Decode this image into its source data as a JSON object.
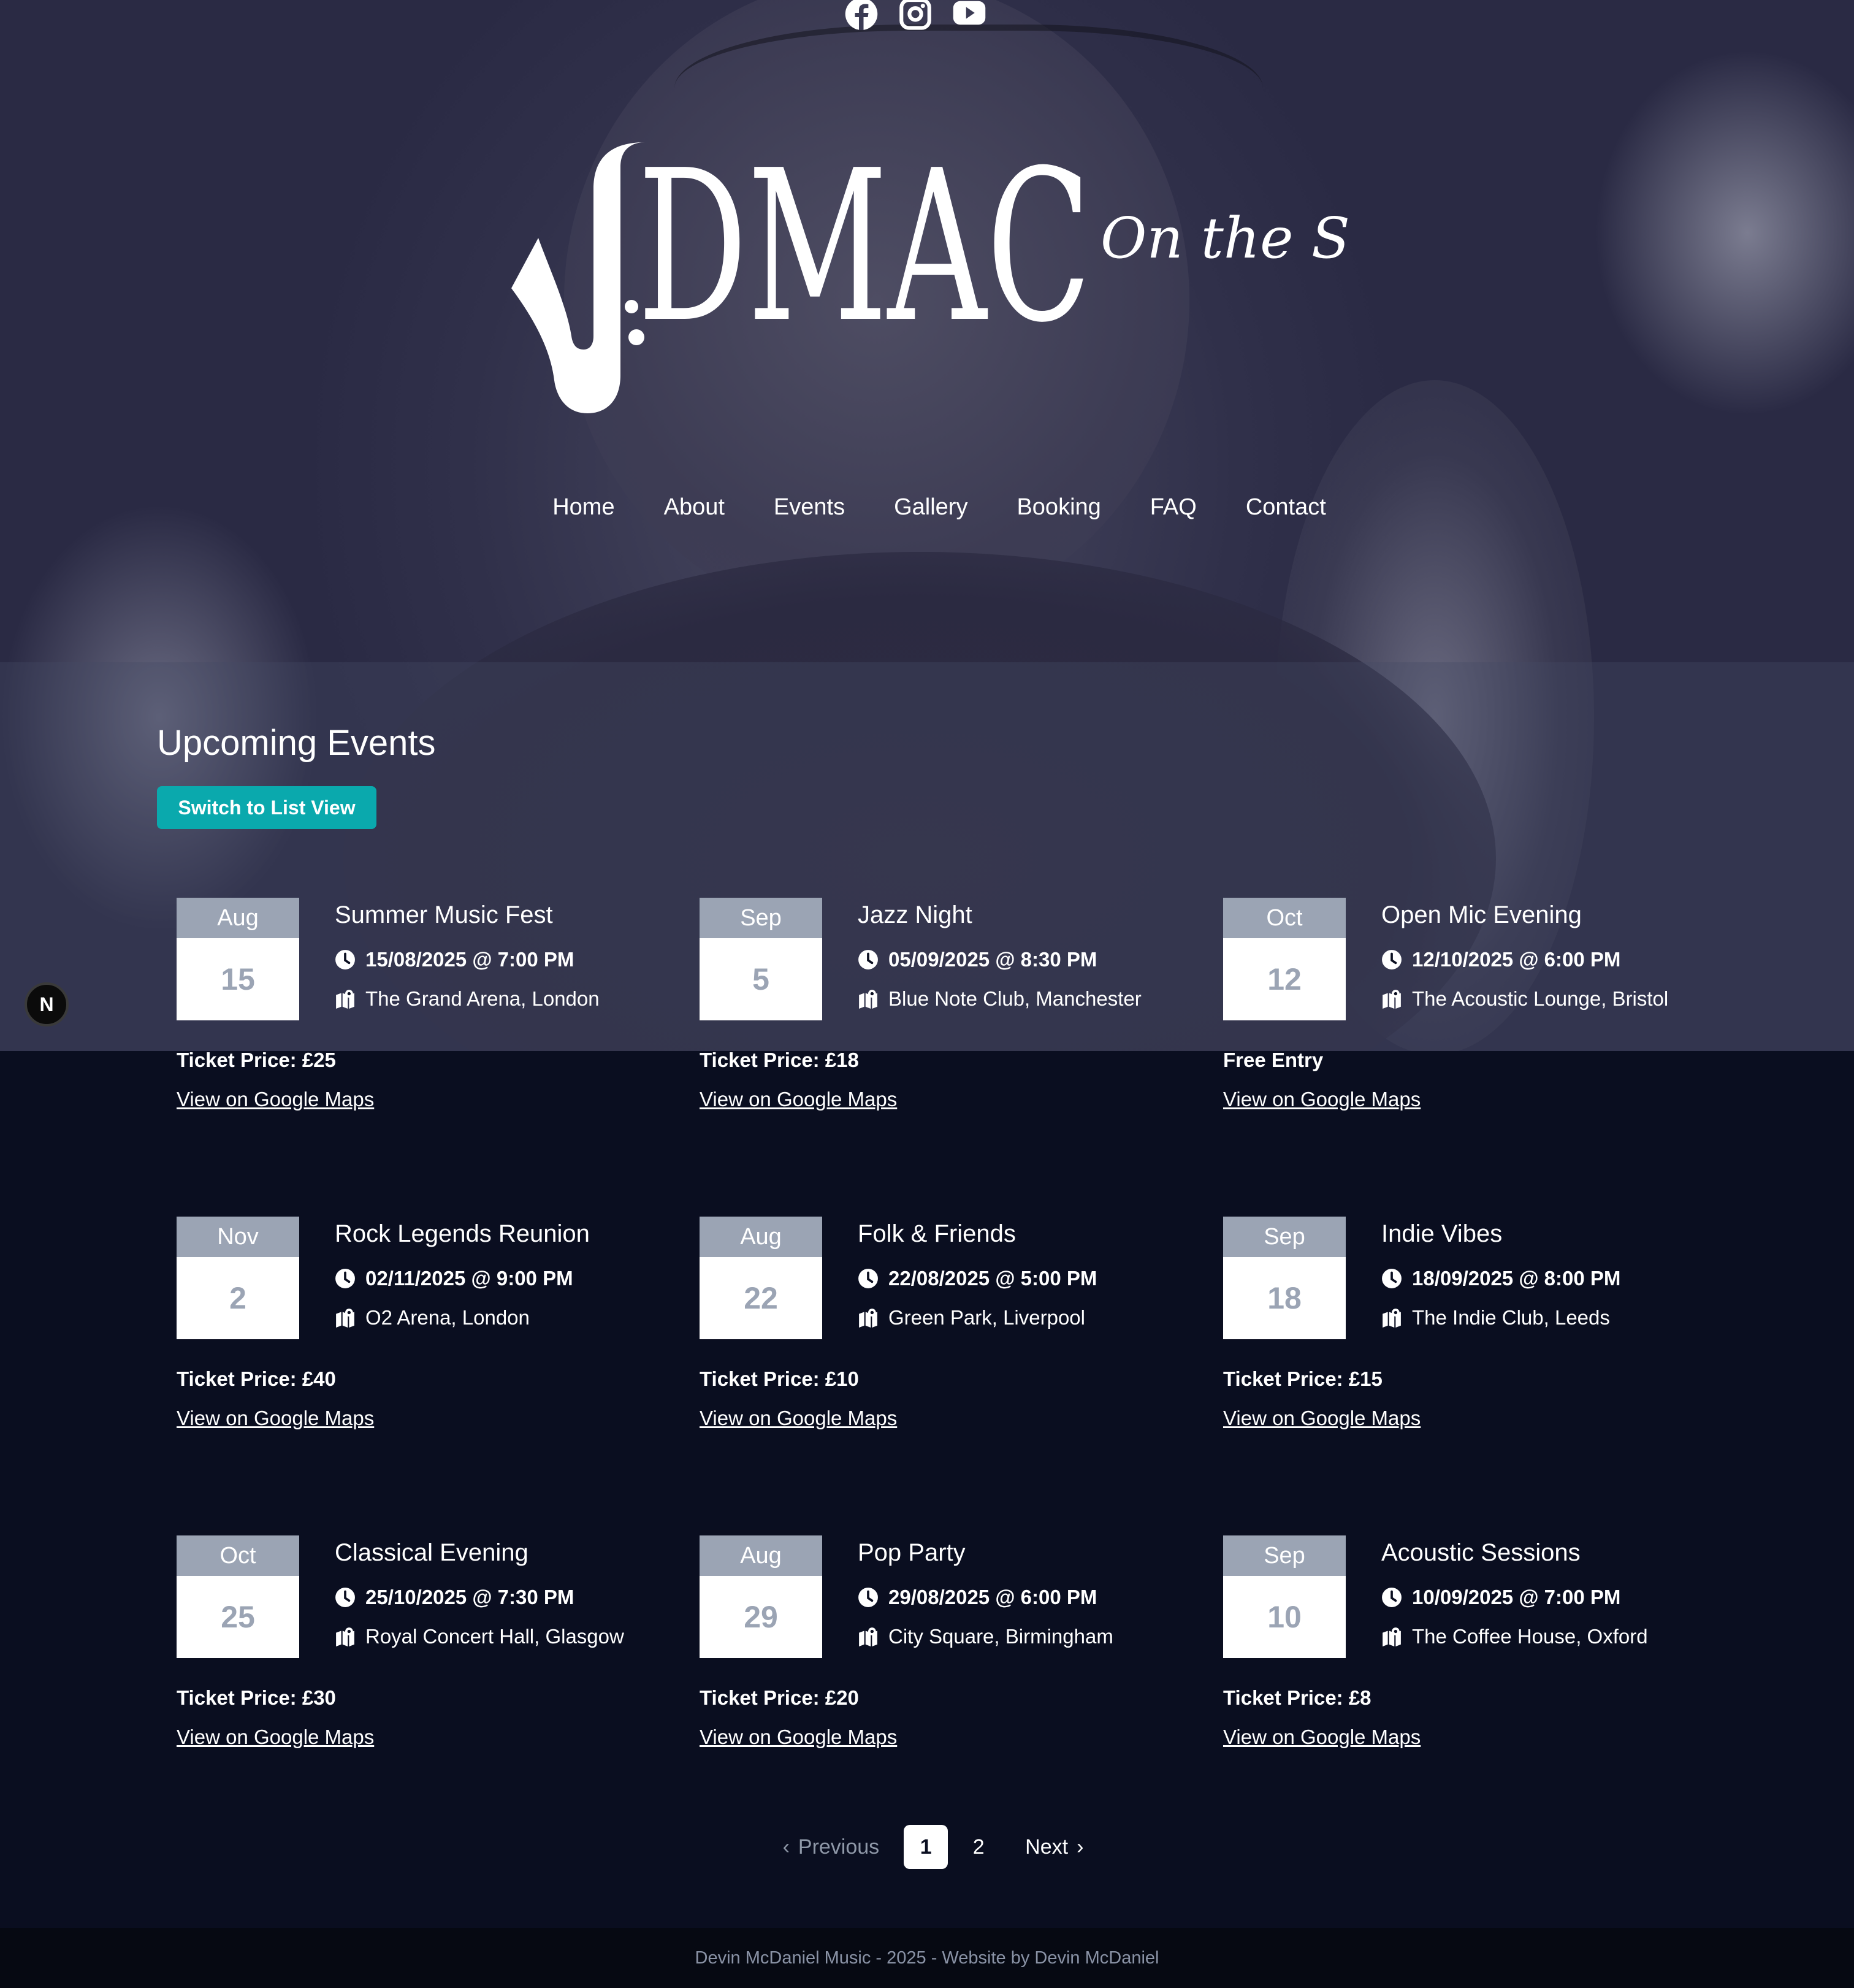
{
  "social": [
    "facebook-icon",
    "instagram-icon",
    "youtube-icon"
  ],
  "logo": {
    "main": "DMAC",
    "script": "On the Sax"
  },
  "nav": {
    "items": [
      "Home",
      "About",
      "Events",
      "Gallery",
      "Booking",
      "FAQ",
      "Contact"
    ]
  },
  "events": {
    "title": "Upcoming Events",
    "switch_label": "Switch to List View",
    "maps_label": "View on Google Maps",
    "items": [
      {
        "month": "Aug",
        "day": "15",
        "name": "Summer Music Fest",
        "datetime": "15/08/2025 @ 7:00 PM",
        "venue": "The Grand Arena, London",
        "price": "Ticket Price: £25"
      },
      {
        "month": "Sep",
        "day": "5",
        "name": "Jazz Night",
        "datetime": "05/09/2025 @ 8:30 PM",
        "venue": "Blue Note Club, Manchester",
        "price": "Ticket Price: £18"
      },
      {
        "month": "Oct",
        "day": "12",
        "name": "Open Mic Evening",
        "datetime": "12/10/2025 @ 6:00 PM",
        "venue": "The Acoustic Lounge, Bristol",
        "price": "Free Entry"
      },
      {
        "month": "Nov",
        "day": "2",
        "name": "Rock Legends Reunion",
        "datetime": "02/11/2025 @ 9:00 PM",
        "venue": "O2 Arena, London",
        "price": "Ticket Price: £40"
      },
      {
        "month": "Aug",
        "day": "22",
        "name": "Folk & Friends",
        "datetime": "22/08/2025 @ 5:00 PM",
        "venue": "Green Park, Liverpool",
        "price": "Ticket Price: £10"
      },
      {
        "month": "Sep",
        "day": "18",
        "name": "Indie Vibes",
        "datetime": "18/09/2025 @ 8:00 PM",
        "venue": "The Indie Club, Leeds",
        "price": "Ticket Price: £15"
      },
      {
        "month": "Oct",
        "day": "25",
        "name": "Classical Evening",
        "datetime": "25/10/2025 @ 7:30 PM",
        "venue": "Royal Concert Hall, Glasgow",
        "price": "Ticket Price: £30"
      },
      {
        "month": "Aug",
        "day": "29",
        "name": "Pop Party",
        "datetime": "29/08/2025 @ 6:00 PM",
        "venue": "City Square, Birmingham",
        "price": "Ticket Price: £20"
      },
      {
        "month": "Sep",
        "day": "10",
        "name": "Acoustic Sessions",
        "datetime": "10/09/2025 @ 7:00 PM",
        "venue": "The Coffee House, Oxford",
        "price": "Ticket Price: £8"
      }
    ]
  },
  "pagination": {
    "previous": "Previous",
    "pages": [
      "1",
      "2"
    ],
    "current": "1",
    "next": "Next"
  },
  "badge": "N",
  "footer": "Devin McDaniel Music - 2025 - Website by Devin McDaniel"
}
